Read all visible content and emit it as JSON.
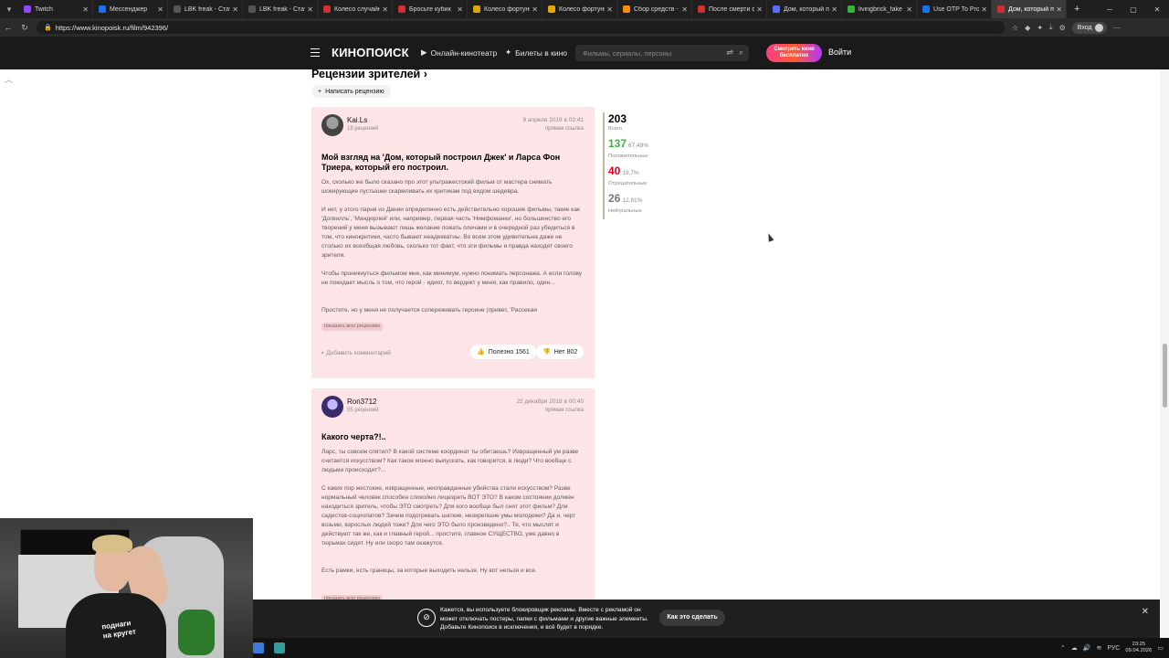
{
  "browser": {
    "tabs": [
      {
        "title": "Twitch",
        "color": "#9146ff"
      },
      {
        "title": "Мессенджер",
        "color": "#1a73e8"
      },
      {
        "title": "LBK freak - Статистика",
        "color": "#555555"
      },
      {
        "title": "LBK freak - Статистика",
        "color": "#555555"
      },
      {
        "title": "Колесо случайного",
        "color": "#d0312d"
      },
      {
        "title": "Бросьте кубик",
        "color": "#d0312d"
      },
      {
        "title": "Колесо фортуны дл",
        "color": "#e0a800"
      },
      {
        "title": "Колесо фортуны дл",
        "color": "#e0a800"
      },
      {
        "title": "Сбор средств - Вид",
        "color": "#ff8a00"
      },
      {
        "title": "После смерти фил",
        "color": "#d0312d"
      },
      {
        "title": "Дом, который пост",
        "color": "#5b6cff"
      },
      {
        "title": "livingbrick_fake Stre",
        "color": "#35b535"
      },
      {
        "title": "Use OTP To Procee",
        "color": "#1a73e8"
      },
      {
        "title": "Дом, который пост",
        "color": "#d0312d"
      }
    ],
    "url": "https://www.kinopoisk.ru/film/942396/",
    "login_label": "Вход"
  },
  "site": {
    "logo": "КИНОПОИСК",
    "nav_online": "Онлайн-кинотеатр",
    "nav_tickets": "Билеты в кино",
    "search_placeholder": "Фильмы, сериалы, персоны",
    "watch_free_line1": "Смотреть кино",
    "watch_free_line2": "бесплатно",
    "login": "Войти"
  },
  "reviews_section": {
    "title": "Рецензии зрителей",
    "write_button": "Написать рецензию"
  },
  "reviews": [
    {
      "author": "Kai.Ls",
      "reviews_count": "18 рецензий",
      "date": "9 апреля 2019 в 02:41",
      "direct_link": "прямая ссылка",
      "title": "Мой взгляд на 'Дом, который построил Джек' и Ларса Фон Триера, который его построил.",
      "paragraphs": [
        "Ох, сколько же было сказано про этот ультражестокий фильм от мастера снимать шокирующие пустышки скармливать их критикам под видом шедевра.",
        "И нет, у этого парня из Дании определенно есть действительно хорошие фильмы, такие как 'Догвилль', 'Мандерлей' или, например, первая часть 'Нимфоманки', но большинство его творений у меня вызывают лишь желание пожать плечами и в очередной раз убедиться в том, что кинокритики, часто бывают неадекватны. Во всем этом удивительна даже не столько их всеобщая любовь, сколько тот факт, что эти фильмы и правда находят своего зрителя.",
        "Чтобы проникнуться фильмом мне, как минимум, нужно понимать персонажа. А если голову не покидает мысль о том, что герой - идиот, то вердикт у меня, как правило, один...",
        "Простите, но у меня не получается сопереживать героине (привет, 'Рассекая"
      ],
      "show_all": "показать всю рецензию",
      "add_comment": "Добавить комментарий",
      "useful": "Полезно 1561",
      "not_useful": "Нет 802"
    },
    {
      "author": "Ron3712",
      "reviews_count": "55 рецензий",
      "date": "22 декабря 2018 в 00:40",
      "direct_link": "прямая ссылка",
      "title": "Какого черта?!..",
      "paragraphs": [
        "Ларс, ты совсем спятил? В какой системе координат ты обитаешь? Извращенный ум разве считается искусством? Как такое можно выпускать, как говорится, в люди? Что вообще с людьми происходит?...",
        "С каких пор жестокие, извращенные, неоправданные убийства стали искусством? Разве нормальный человек способен спокойно лицезреть ВОТ ЭТО? В каком состоянии должен находиться зритель, чтобы ЭТО смотреть? Для кого вообще был снят этот фильм? Для садистов-социопатов? Зачем подогревать шаткие, неокрепшие умы молодежи? Да и, черт возьми, взрослых людей тоже? Для чего ЭТО было произведено?.. Те, что мыслят и действуют так же, как и главный герой... простите, главное СУЩЕСТВО, уже давно в тюрьмах сидят. Ну или скоро там окажутся.",
        "Есть рамки, есть границы, за которые выходить нельзя. Ну вот нельзя и все."
      ],
      "show_all": "показать всю рецензию"
    }
  ],
  "stats": {
    "total": "203",
    "total_label": "Всего",
    "positive": "137",
    "positive_pct": "67,49%",
    "positive_label": "Положительные",
    "negative": "40",
    "negative_pct": "19,7%",
    "negative_label": "Отрицательные",
    "neutral": "26",
    "neutral_pct": "12,81%",
    "neutral_label": "Нейтральные"
  },
  "adblock": {
    "text": "Кажется, вы используете блокировщик рекламы. Вместе с рекламой он может отключать постеры, папки с фильмами и другие важные элементы. Добавьте Кинопоиск в исключения, и всё будет в порядке.",
    "button": "Как это сделать"
  },
  "webcam": {
    "shirt_line1": "поднаги",
    "shirt_line2": "на кругет"
  },
  "taskbar": {
    "lang": "РУС",
    "time": "23:25",
    "date": "09.04.2026"
  }
}
